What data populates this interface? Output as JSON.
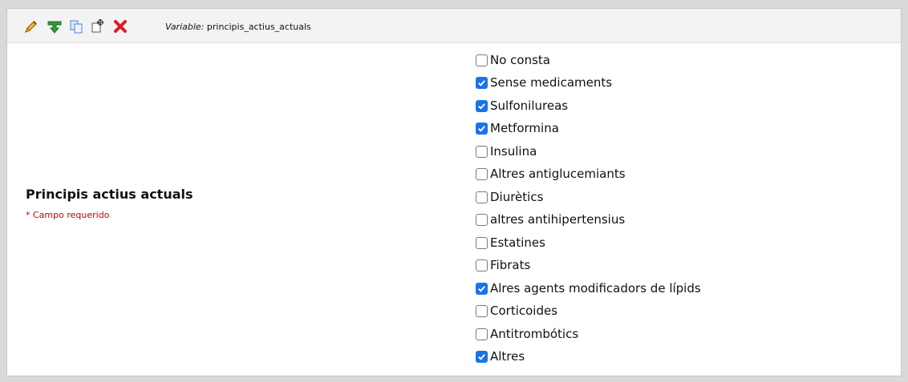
{
  "toolbar": {
    "variable_label": "Variable:",
    "variable_name": "principis_actius_actuals",
    "icons": [
      "pencil-icon",
      "branch-icon",
      "copy-icon",
      "move-icon",
      "delete-icon"
    ]
  },
  "question": {
    "title": "Principis actius actuals",
    "required_text": "* Campo requerido"
  },
  "options": [
    {
      "label": "No consta",
      "checked": false
    },
    {
      "label": "Sense medicaments",
      "checked": true
    },
    {
      "label": "Sulfonilureas",
      "checked": true
    },
    {
      "label": "Metformina",
      "checked": true
    },
    {
      "label": "Insulina",
      "checked": false
    },
    {
      "label": "Altres antiglucemiants",
      "checked": false
    },
    {
      "label": "Diurètics",
      "checked": false
    },
    {
      "label": "altres antihipertensius",
      "checked": false
    },
    {
      "label": "Estatines",
      "checked": false
    },
    {
      "label": "Fibrats",
      "checked": false
    },
    {
      "label": "Alres agents modificadors de lípids",
      "checked": true
    },
    {
      "label": "Corticoides",
      "checked": false
    },
    {
      "label": "Antitrombótics",
      "checked": false
    },
    {
      "label": "Altres",
      "checked": true
    }
  ],
  "colors": {
    "checkbox_checked": "#1a73e8",
    "required_text": "#d20000",
    "toolbar_background": "#f3f3f3"
  }
}
